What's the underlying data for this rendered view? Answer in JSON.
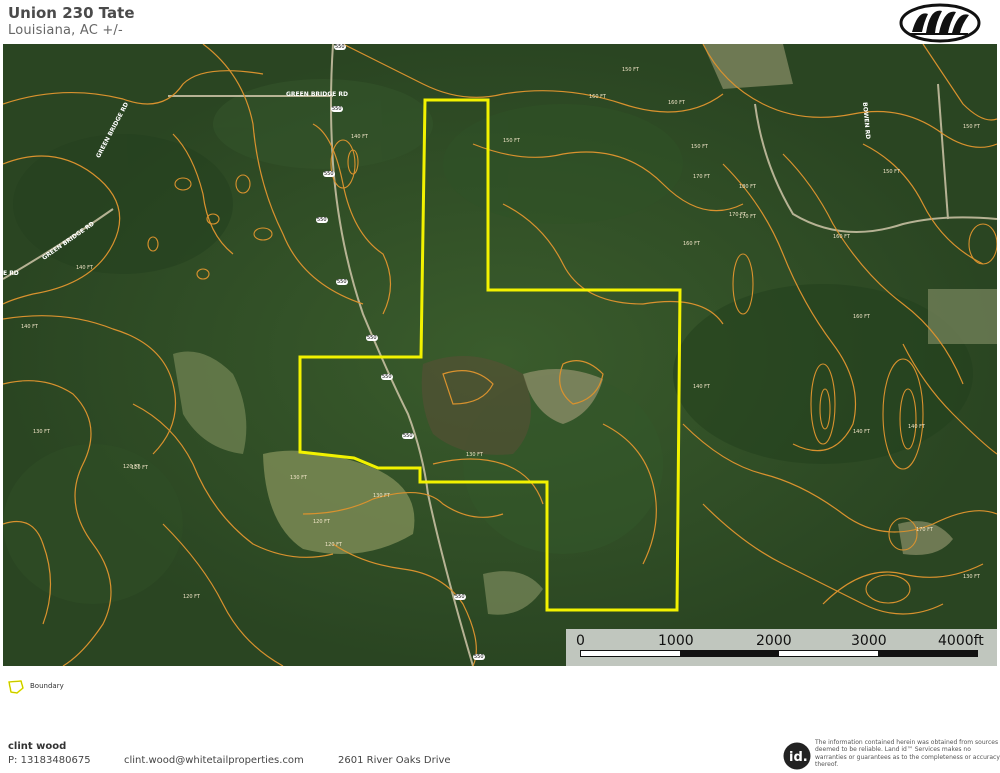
{
  "header": {
    "title": "Union 230 Tate",
    "subtitle": "Louisiana,  AC +/-",
    "logo_icon": "bear-paw-logo-icon"
  },
  "map": {
    "imagery": "satellite",
    "colors": {
      "boundary": "#f2f200",
      "contour": "#d9922e",
      "forest": "#2c4a24"
    },
    "road_labels": [
      "GREEN BRIDGE RD",
      "GREEN BRIDGE RD",
      "GREEN BRIDGE RD",
      "E RD",
      "BOWEN RD"
    ],
    "route_shields": [
      "550",
      "550",
      "550",
      "550",
      "550",
      "550",
      "550",
      "550",
      "550",
      "550"
    ],
    "contour_labels": [
      "140 FT",
      "150 FT",
      "160 FT",
      "170 FT",
      "130 FT",
      "120 FT",
      "140 FT",
      "150 FT",
      "160 FT",
      "170 FT",
      "140 FT",
      "120 FT",
      "130 FT",
      "130 FT",
      "120 FT",
      "120 FT",
      "140 FT",
      "150 FT",
      "160 FT",
      "170 FT",
      "180 FT",
      "160 FT",
      "150 FT",
      "140 FT",
      "130 FT",
      "170 FT",
      "160 FT",
      "150 FT",
      "140 FT",
      "130 FT",
      "120 FT"
    ]
  },
  "scale_bar": {
    "labels": [
      "0",
      "1000",
      "2000",
      "3000",
      "4000ft"
    ]
  },
  "legend": {
    "items": [
      {
        "label": "Boundary",
        "icon": "boundary-polygon-icon",
        "color": "#f2f200"
      }
    ]
  },
  "footer": {
    "agent_name": "clint wood",
    "phone": "P: 13183480675",
    "email": "clint.wood@whitetailproperties.com",
    "address": "2601 River Oaks Drive",
    "disclaimer": "The information contained herein was obtained from sources deemed to be reliable. Land id™ Services makes no warranties or guarantees as to the completeness or accuracy thereof.",
    "provider_logo_text": "id."
  }
}
